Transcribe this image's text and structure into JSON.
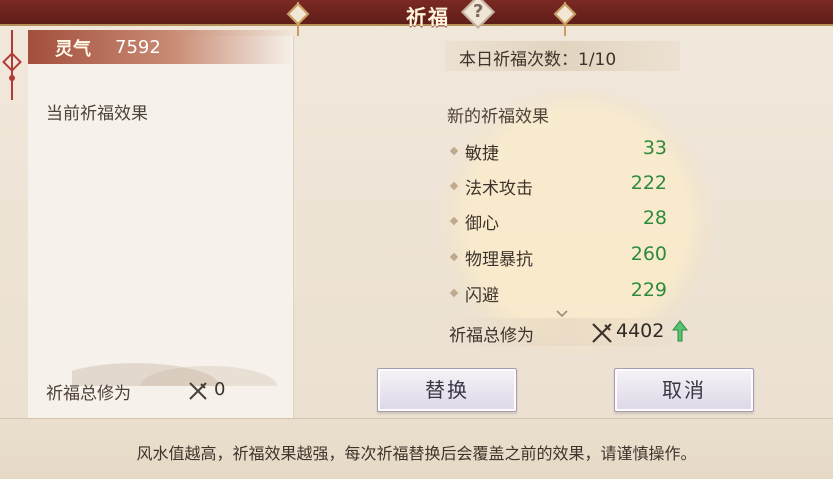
{
  "header": {
    "title": "祈福",
    "help_symbol": "?"
  },
  "left": {
    "currency_label": "灵气",
    "currency_value": "7592",
    "section_title": "当前祈福效果",
    "total_label": "祈福总修为",
    "total_value": "0"
  },
  "right": {
    "daily_count_text": "本日祈福次数：1/10",
    "section_title": "新的祈福效果",
    "stats": [
      {
        "name": "敏捷",
        "value": "33"
      },
      {
        "name": "法术攻击",
        "value": "222"
      },
      {
        "name": "御心",
        "value": "28"
      },
      {
        "name": "物理暴抗",
        "value": "260"
      },
      {
        "name": "闪避",
        "value": "229"
      }
    ],
    "total_label": "祈福总修为",
    "total_value": "4402"
  },
  "buttons": {
    "replace": "替换",
    "cancel": "取消"
  },
  "notice": "风水值越高，祈福效果越强，每次祈福替换后会覆盖之前的效果，请谨慎操作。",
  "colors": {
    "stat_value": "#2e8b3c",
    "title_bar": "#6d231d",
    "currency_bar": "#a34f3d"
  },
  "icons": [
    "help-icon",
    "swords-icon",
    "chevron-down-icon",
    "up-arrow-icon"
  ]
}
